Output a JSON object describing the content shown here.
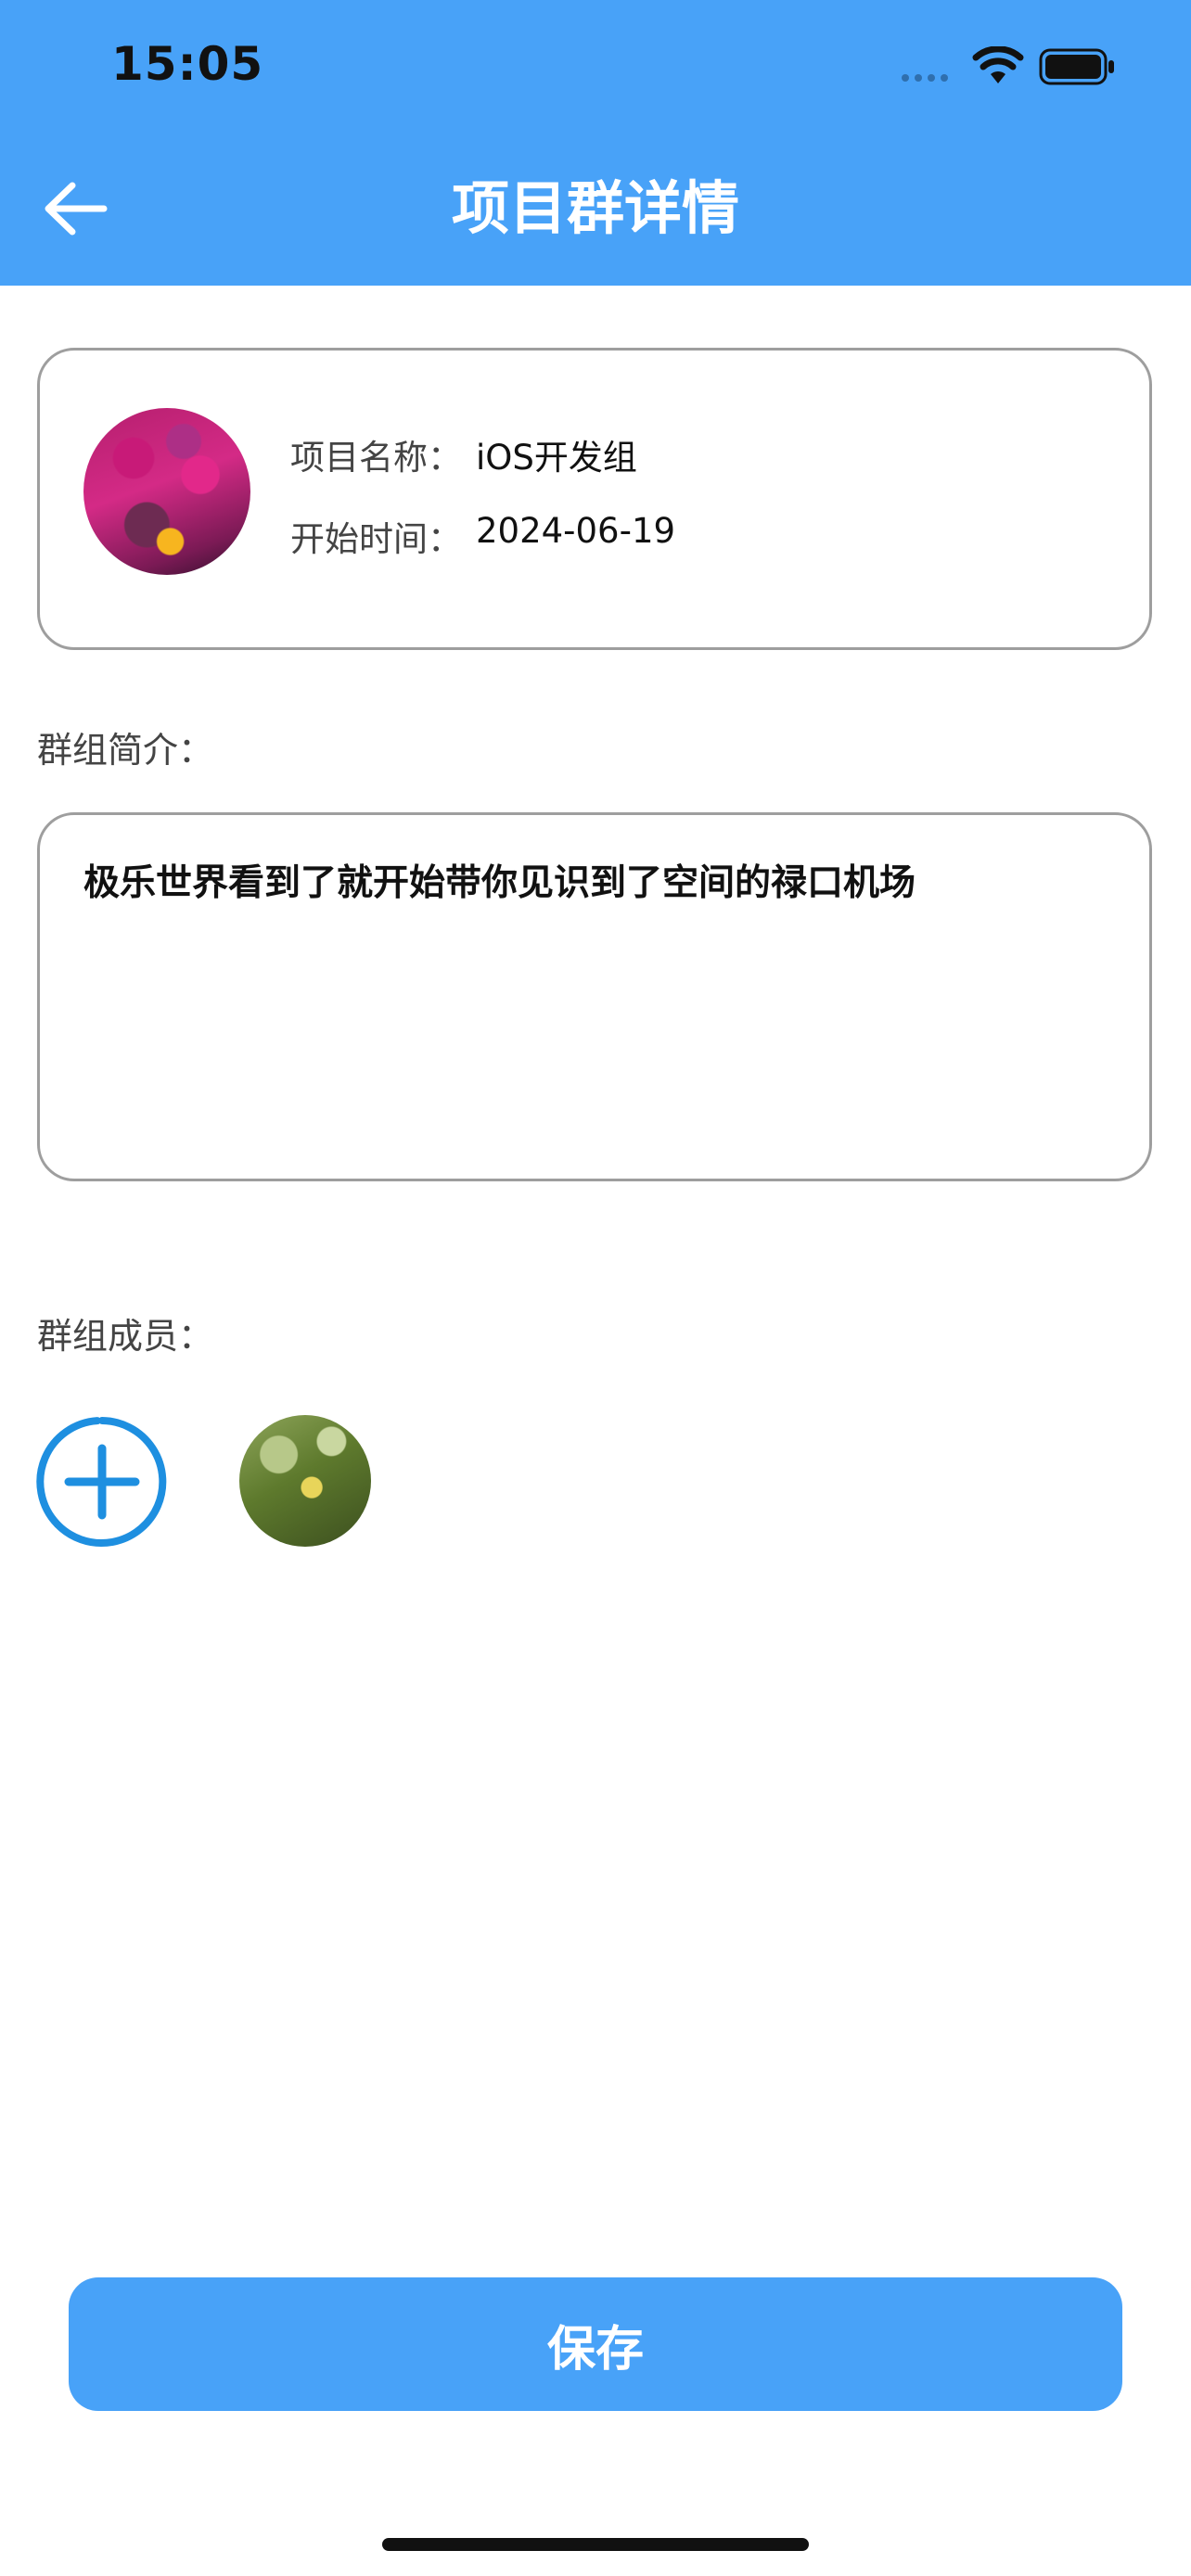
{
  "status_bar": {
    "time": "15:05"
  },
  "nav": {
    "title": "项目群详情"
  },
  "project": {
    "name_label": "项目名称：",
    "name_value": "iOS开发组",
    "start_label": "开始时间：",
    "start_value": "2024-06-19"
  },
  "intro": {
    "label": "群组简介：",
    "text": "极乐世界看到了就开始带你见识到了空间的禄口机场"
  },
  "members": {
    "label": "群组成员："
  },
  "actions": {
    "save_label": "保存"
  },
  "colors": {
    "accent": "#48A2F8",
    "add_icon": "#1E8FE0"
  },
  "icons": [
    "back-arrow-icon",
    "wifi-icon",
    "battery-icon",
    "add-circle-icon"
  ]
}
